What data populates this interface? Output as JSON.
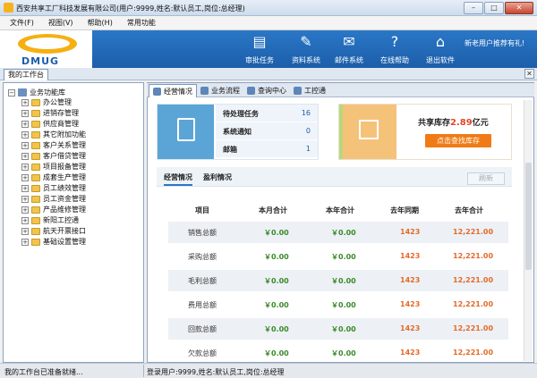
{
  "window": {
    "title": "西安共享工厂科技发展有限公司(用户:9999,姓名:默认员工,岗位:总经理)",
    "minimize": "–",
    "maximize": "□",
    "close": "✕"
  },
  "menu": [
    "文件(F)",
    "视图(V)",
    "帮助(H)",
    "常用功能"
  ],
  "logo": {
    "text": "DMUG"
  },
  "toolbar": [
    {
      "label": "审批任务",
      "icon": "clipboard-icon"
    },
    {
      "label": "资料系统",
      "icon": "edit-document-icon"
    },
    {
      "label": "邮件系统",
      "icon": "mail-icon"
    },
    {
      "label": "在线帮助",
      "icon": "help-icon"
    },
    {
      "label": "退出软件",
      "icon": "exit-house-icon"
    }
  ],
  "banner_note": "新老用户推荐有礼!",
  "workbench_tab": "我的工作台",
  "workbench_close": "✕",
  "tree": {
    "root": "业务功能库",
    "items": [
      "办公管理",
      "进销存管理",
      "供应商管理",
      "其它附加功能",
      "客户关系管理",
      "客户借贷管理",
      "项目报备管理",
      "成套生产管理",
      "员工绩效管理",
      "员工资金管理",
      "产品维修管理",
      "新阳工控通",
      "航天开票接口",
      "基础设置管理"
    ]
  },
  "tabs": [
    "经营情况",
    "业务流程",
    "查询中心",
    "工控通"
  ],
  "summary": {
    "rows": [
      {
        "label": "待处理任务",
        "value": "16"
      },
      {
        "label": "系统通知",
        "value": "0"
      },
      {
        "label": "邮箱",
        "value": "1"
      }
    ]
  },
  "stock": {
    "label": "共享库存",
    "amount": "2.89",
    "unit": "亿元",
    "button": "点击查找库存"
  },
  "subtabs": [
    "经营情况",
    "盈利情况"
  ],
  "refresh": "刷新",
  "table": {
    "headers": [
      "项目",
      "本月合计",
      "本年合计",
      "去年同期",
      "去年合计"
    ],
    "rows": [
      [
        "销售总额",
        "￥0.00",
        "￥0.00",
        "1423",
        "12,221.00"
      ],
      [
        "采购总额",
        "￥0.00",
        "￥0.00",
        "1423",
        "12,221.00"
      ],
      [
        "毛利总额",
        "￥0.00",
        "￥0.00",
        "1423",
        "12,221.00"
      ],
      [
        "费用总额",
        "￥0.00",
        "￥0.00",
        "1423",
        "12,221.00"
      ],
      [
        "回款总额",
        "￥0.00",
        "￥0.00",
        "1423",
        "12,221.00"
      ],
      [
        "欠款总额",
        "￥0.00",
        "￥0.00",
        "1423",
        "12,221.00"
      ]
    ]
  },
  "status": {
    "left": "我的工作台已准备就绪...",
    "right": "登录用户:9999,姓名:默认员工,岗位:总经理"
  },
  "colors": {
    "banner": "#2a77c7",
    "accent_orange": "#f07b16",
    "value_green": "#3a8a2a",
    "value_red": "#e36a2b",
    "card_blue": "#5aa5d6",
    "card_orange": "#f5c27a"
  }
}
